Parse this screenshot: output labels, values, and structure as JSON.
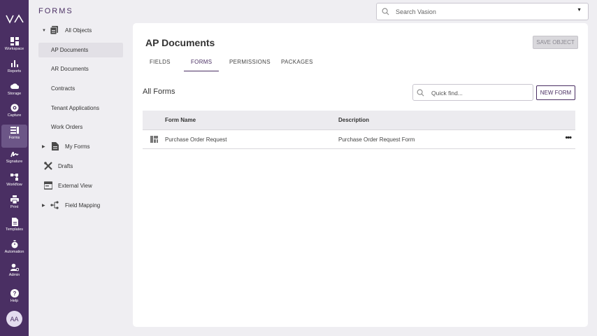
{
  "rail": {
    "items": [
      {
        "label": "Workspace",
        "icon": "workspace-icon"
      },
      {
        "label": "Reports",
        "icon": "reports-icon"
      },
      {
        "label": "Storage",
        "icon": "cloud-icon"
      },
      {
        "label": "Capture",
        "icon": "capture-icon"
      },
      {
        "label": "Forms",
        "icon": "forms-icon"
      },
      {
        "label": "Signature",
        "icon": "signature-icon"
      },
      {
        "label": "Workflow",
        "icon": "workflow-icon"
      },
      {
        "label": "Print",
        "icon": "print-icon"
      },
      {
        "label": "Templates",
        "icon": "templates-icon"
      },
      {
        "label": "Automation",
        "icon": "stopwatch-icon"
      },
      {
        "label": "Admin",
        "icon": "admin-icon"
      },
      {
        "label": "Help",
        "icon": "help-icon"
      }
    ],
    "avatar": "AA"
  },
  "nav": {
    "title": "FORMS",
    "items": [
      {
        "label": "All Objects"
      },
      {
        "label": "AP Documents"
      },
      {
        "label": "AR Documents"
      },
      {
        "label": "Contracts"
      },
      {
        "label": "Tenant Applications"
      },
      {
        "label": "Work Orders"
      },
      {
        "label": "My Forms"
      },
      {
        "label": "Drafts"
      },
      {
        "label": "External View"
      },
      {
        "label": "Field Mapping"
      }
    ]
  },
  "search": {
    "placeholder": "Search Vasion"
  },
  "main": {
    "title": "AP Documents",
    "save_label": "SAVE OBJECT",
    "tabs": [
      {
        "label": "FIELDS"
      },
      {
        "label": "FORMS"
      },
      {
        "label": "PERMISSIONS"
      },
      {
        "label": "PACKAGES"
      }
    ],
    "section_title": "All Forms",
    "quickfind_placeholder": "Quick find...",
    "new_label": "NEW FORM",
    "table": {
      "headers": [
        "Form Name",
        "Description"
      ],
      "rows": [
        {
          "name": "Purchase Order Request",
          "description": "Purchase Order Request Form"
        }
      ]
    }
  },
  "colors": {
    "brand": "#4a2f63",
    "active_rail": "#6c5687"
  }
}
